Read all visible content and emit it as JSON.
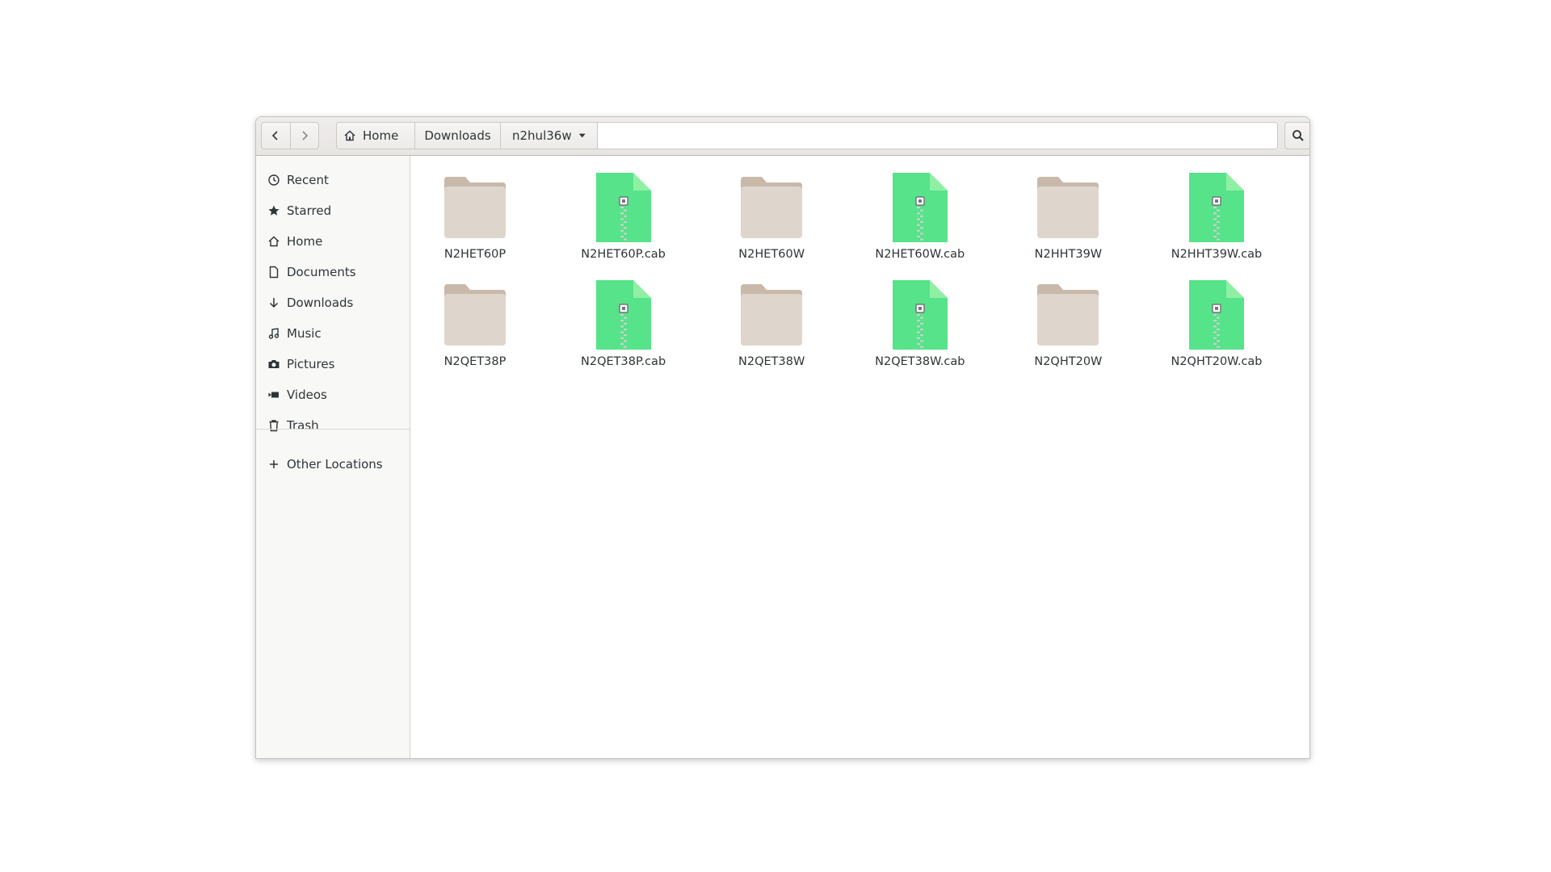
{
  "window": {
    "path": [
      "Home",
      "Downloads",
      "n2hul36w"
    ]
  },
  "sidebar": {
    "items": [
      {
        "label": "Recent",
        "icon": "clock-icon"
      },
      {
        "label": "Starred",
        "icon": "star-icon"
      },
      {
        "label": "Home",
        "icon": "home-icon"
      },
      {
        "label": "Documents",
        "icon": "document-icon"
      },
      {
        "label": "Downloads",
        "icon": "download-icon"
      },
      {
        "label": "Music",
        "icon": "music-icon"
      },
      {
        "label": "Pictures",
        "icon": "camera-icon"
      },
      {
        "label": "Videos",
        "icon": "video-icon"
      },
      {
        "label": "Trash",
        "icon": "trash-icon"
      }
    ],
    "other": {
      "label": "Other Locations",
      "icon": "plus-icon"
    }
  },
  "files": [
    {
      "name": "N2HET60P",
      "type": "folder"
    },
    {
      "name": "N2HET60P.cab",
      "type": "archive"
    },
    {
      "name": "N2HET60W",
      "type": "folder"
    },
    {
      "name": "N2HET60W.cab",
      "type": "archive"
    },
    {
      "name": "N2HHT39W",
      "type": "folder"
    },
    {
      "name": "N2HHT39W.cab",
      "type": "archive"
    },
    {
      "name": "N2QET38P",
      "type": "folder"
    },
    {
      "name": "N2QET38P.cab",
      "type": "archive"
    },
    {
      "name": "N2QET38W",
      "type": "folder"
    },
    {
      "name": "N2QET38W.cab",
      "type": "archive"
    },
    {
      "name": "N2QHT20W",
      "type": "folder"
    },
    {
      "name": "N2QHT20W.cab",
      "type": "archive"
    }
  ],
  "colors": {
    "folder": "#ded6cc",
    "folder_tab": "#c8b9aa",
    "archive": "#57e389",
    "archive_fold": "#8ff0a4"
  }
}
